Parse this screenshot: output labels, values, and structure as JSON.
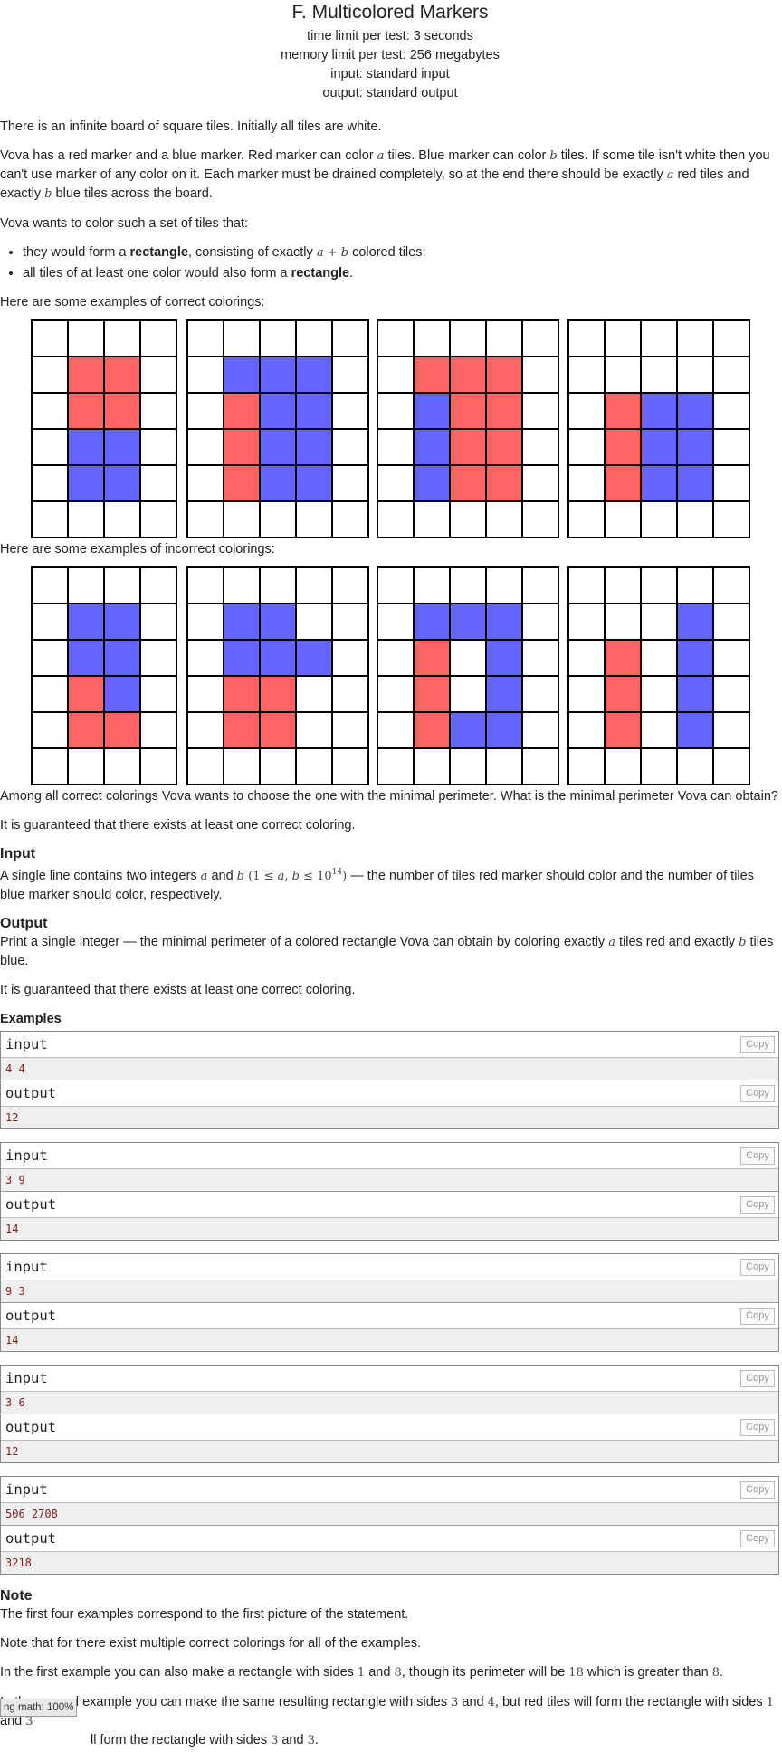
{
  "problem": {
    "title": "F. Multicolored Markers",
    "limits": [
      "time limit per test: 3 seconds",
      "memory limit per test: 256 megabytes",
      "input: standard input",
      "output: standard output"
    ]
  },
  "statement": {
    "p1": "There is an infinite board of square tiles. Initially all tiles are white.",
    "p2": {
      "t1": "Vova has a red marker and a blue marker. Red marker can color ",
      "m1": "a",
      "t2": " tiles. Blue marker can color ",
      "m2": "b",
      "t3": " tiles. If some tile isn't white then you can't use marker of any color on it. Each marker must be drained completely, so at the end there should be exactly ",
      "m3": "a",
      "t4": " red tiles and exactly ",
      "m4": "b",
      "t5": " blue tiles across the board."
    },
    "p3": "Vova wants to color such a set of tiles that:",
    "bullet1": {
      "t1": "they would form a ",
      "b1": "rectangle",
      "t2": ", consisting of exactly ",
      "m1": "a + b",
      "t3": " colored tiles;"
    },
    "bullet2": {
      "t1": "all tiles of at least one color would also form a ",
      "b1": "rectangle",
      "t2": "."
    },
    "correct_caption": "Here are some examples of correct colorings:",
    "incorrect_caption": "Here are some examples of incorrect colorings:",
    "p4": "Among all correct colorings Vova wants to choose the one with the minimal perimeter. What is the minimal perimeter Vova can obtain?",
    "p5": "It is guaranteed that there exists at least one correct coloring."
  },
  "colors": {
    "red": "#ff6464",
    "blue": "#6464ff",
    "white": "#ffffff",
    "line": "#000000"
  },
  "figures": {
    "correct": [
      {
        "cols": 4,
        "rows": 6,
        "cells": [
          "....",
          ".RR.",
          ".RR.",
          ".BB.",
          ".BB.",
          "...."
        ]
      },
      {
        "cols": 5,
        "rows": 6,
        "cells": [
          ".....",
          ".BBB.",
          ".RBB.",
          ".RBB.",
          ".RBB.",
          "....."
        ]
      },
      {
        "cols": 5,
        "rows": 6,
        "cells": [
          ".....",
          ".RRR.",
          ".BRR.",
          ".BRR.",
          ".BRR.",
          "....."
        ]
      },
      {
        "cols": 5,
        "rows": 6,
        "cells": [
          ".....",
          ".....",
          ".RBB.",
          ".RBB.",
          ".RBB.",
          "....."
        ]
      }
    ],
    "incorrect": [
      {
        "cols": 4,
        "rows": 6,
        "cells": [
          "....",
          ".BB.",
          ".BB.",
          ".RB.",
          ".RR.",
          "...."
        ]
      },
      {
        "cols": 5,
        "rows": 6,
        "cells": [
          ".....",
          ".BB..",
          ".BBB.",
          ".RR..",
          ".RR..",
          "....."
        ]
      },
      {
        "cols": 5,
        "rows": 6,
        "cells": [
          ".....",
          ".BBB.",
          ".R.B.",
          ".R.B.",
          ".RBB.",
          "....."
        ]
      },
      {
        "cols": 5,
        "rows": 6,
        "cells": [
          ".....",
          "...B.",
          ".R.B.",
          ".R.B.",
          ".R.B.",
          "....."
        ]
      }
    ]
  },
  "input_section": {
    "title": "Input",
    "t1": "A single line contains two integers ",
    "m1": "a",
    "t2": " and ",
    "m2": "b",
    "m3_pre": " (1 ≤ ",
    "m3_a": "a",
    "m3_mid": ", ",
    "m3_b": "b",
    "m3_le": " ≤ 10",
    "m3_exp": "14",
    "m3_post": ")",
    "t3": " — the number of tiles red marker should color and the number of tiles blue marker should color, respectively."
  },
  "output_section": {
    "title": "Output",
    "t1": "Print a single integer — the minimal perimeter of a colored rectangle Vova can obtain by coloring exactly ",
    "m1": "a",
    "t2": " tiles red and exactly ",
    "m2": "b",
    "t3": " tiles blue.",
    "p2": "It is guaranteed that there exists at least one correct coloring."
  },
  "examples": {
    "title": "Examples",
    "input_label": "input",
    "output_label": "output",
    "copy_label": "Copy",
    "tests": [
      {
        "input": "4 4",
        "output": "12"
      },
      {
        "input": "3 9",
        "output": "14"
      },
      {
        "input": "9 3",
        "output": "14"
      },
      {
        "input": "3 6",
        "output": "12"
      },
      {
        "input": "506 2708",
        "output": "3218"
      }
    ]
  },
  "note": {
    "title": "Note",
    "p1": "The first four examples correspond to the first picture of the statement.",
    "p2": "Note that for there exist multiple correct colorings for all of the examples.",
    "p3": {
      "t1": "In the first example you can also make a rectangle with sides ",
      "m1": "1",
      "t2": " and ",
      "m2": "8",
      "t3": ", though its perimeter will be ",
      "m3": "18",
      "t4": " which is greater than ",
      "m4": "8",
      "t5": "."
    },
    "p4": {
      "t1": "In the second example you can make the same resulting rectangle with sides ",
      "m1": "3",
      "t2": " and ",
      "m2": "4",
      "t3": ", but red tiles will form the rectangle with sides ",
      "m3": "1",
      "t4": " and ",
      "m4": "3"
    },
    "p5": {
      "t1": "ll form the rectangle with sides ",
      "m1": "3",
      "t2": " and ",
      "m2": "3",
      "t3": "."
    }
  },
  "math_badge": "ng math: 100%"
}
